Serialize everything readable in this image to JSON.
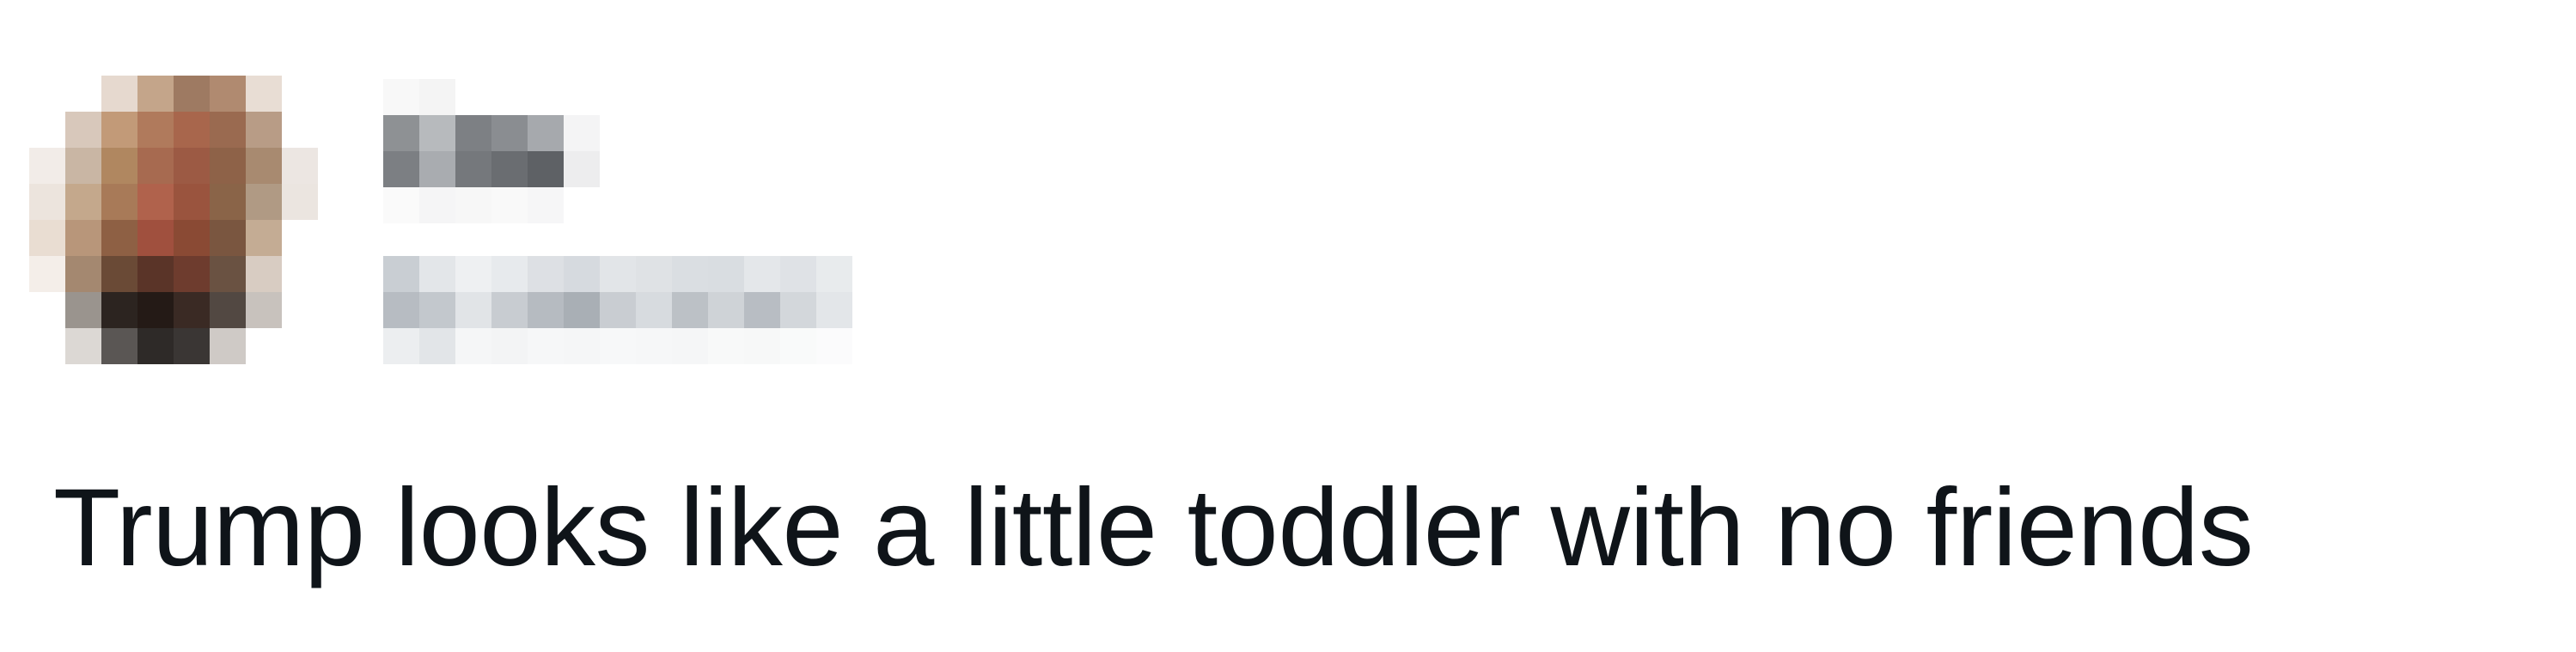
{
  "post": {
    "text": "Trump looks like a little toddler with no friends"
  },
  "author": {
    "avatar_state": "pixelated",
    "name_state": "pixelated",
    "handle_state": "pixelated"
  },
  "colors": {
    "text": "#0f1419",
    "background": "#ffffff"
  }
}
